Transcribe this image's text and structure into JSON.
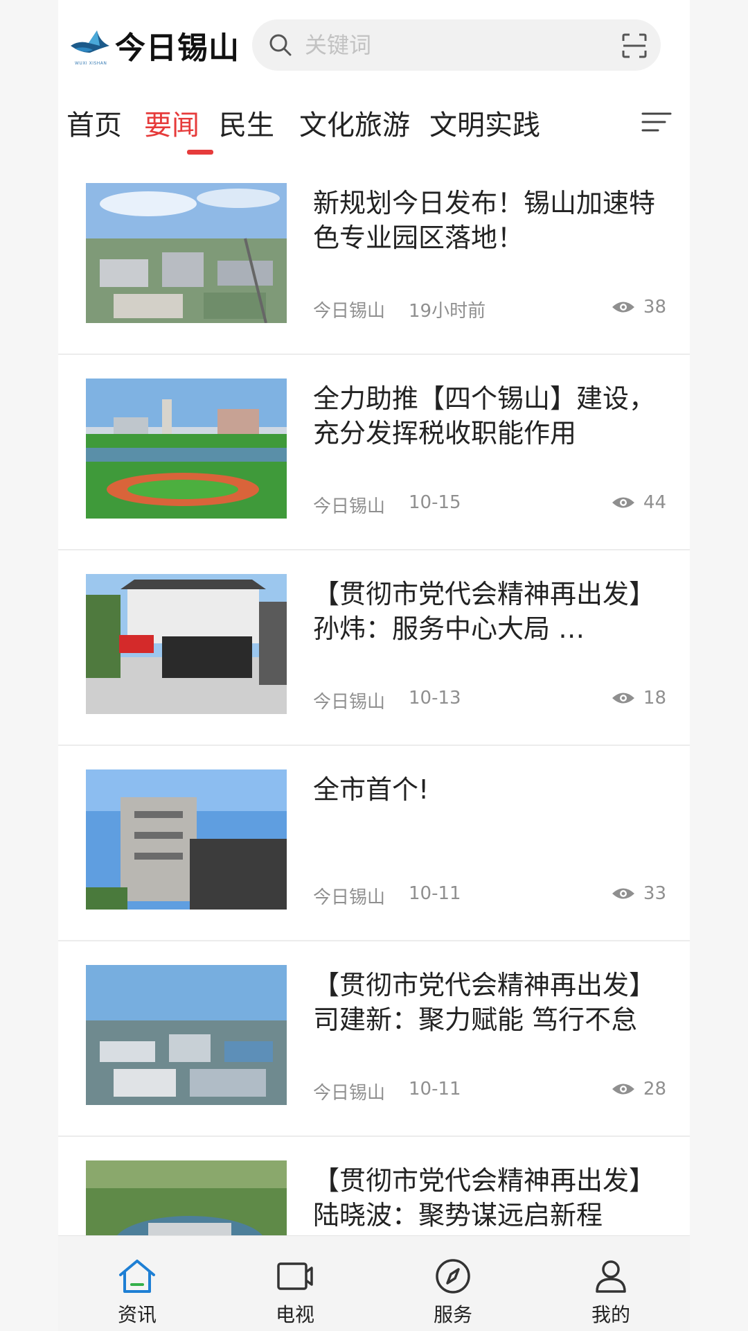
{
  "app": {
    "brand_name": "今日锡山",
    "brand_subtitle": "WUXI  XISHAN"
  },
  "search": {
    "placeholder": "关键词"
  },
  "tabs": [
    {
      "label": "首页"
    },
    {
      "label": "要闻",
      "active": true
    },
    {
      "label": "民生"
    },
    {
      "label": "文化旅游"
    },
    {
      "label": "文明实践"
    }
  ],
  "articles": [
    {
      "title": "新规划今日发布！锡山加速特色专业园区落地！",
      "source": "今日锡山",
      "time": "19小时前",
      "views": "38",
      "image": "industrial-park-aerial"
    },
    {
      "title": "全力助推【四个锡山】建设，充分发挥税收职能作用",
      "source": "今日锡山",
      "time": "10-15",
      "views": "44",
      "image": "city-park-aerial"
    },
    {
      "title": "【贯彻市党代会精神再出发】孙炜：服务中心大局 …",
      "source": "今日锡山",
      "time": "10-13",
      "views": "18",
      "image": "flag-ceremony"
    },
    {
      "title": "全市首个!",
      "source": "今日锡山",
      "time": "10-11",
      "views": "33",
      "image": "apartment-building"
    },
    {
      "title": "【贯彻市党代会精神再出发】司建新：聚力赋能 笃行不怠",
      "source": "今日锡山",
      "time": "10-11",
      "views": "28",
      "image": "factory-district-aerial"
    },
    {
      "title": "【贯彻市党代会精神再出发】陆晓波：聚势谋远启新程",
      "source": "",
      "time": "",
      "views": "",
      "image": "waterfront-aerial"
    }
  ],
  "bottom_nav": [
    {
      "label": "资讯",
      "icon": "home-icon",
      "active": true
    },
    {
      "label": "电视",
      "icon": "video-camera-icon"
    },
    {
      "label": "服务",
      "icon": "compass-icon"
    },
    {
      "label": "我的",
      "icon": "user-icon"
    }
  ],
  "colors": {
    "accent": "#e63b3b",
    "active_nav": "#1e7fd4",
    "text": "#222222",
    "meta": "#8f8f8f"
  }
}
